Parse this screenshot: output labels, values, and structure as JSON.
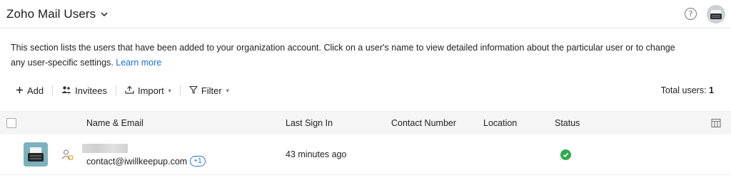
{
  "header": {
    "title": "Zoho Mail Users",
    "help_glyph": "?"
  },
  "description": {
    "text": "This section lists the users that have been added to your organization account. Click on a user's name to view detailed information about the particular user or to change any user-specific settings.",
    "link": "Learn more"
  },
  "toolbar": {
    "add_label": "Add",
    "invitees_label": "Invitees",
    "import_label": "Import",
    "filter_label": "Filter",
    "total_label": "Total users:",
    "total_value": "1"
  },
  "table": {
    "columns": {
      "name_email": "Name & Email",
      "last_sign_in": "Last Sign In",
      "contact_number": "Contact Number",
      "location": "Location",
      "status": "Status"
    },
    "rows": [
      {
        "email": "contact@iwillkeepup.com",
        "extra_count": "+1",
        "last_sign_in": "43 minutes ago",
        "contact_number": "",
        "location": "",
        "status": "active"
      }
    ]
  },
  "colors": {
    "link": "#1a6fd6",
    "status_active": "#2eab4f",
    "header_bg": "#f5f5f5"
  },
  "icons": {
    "title_dropdown": "chevron-down-icon",
    "help": "help-circle-icon",
    "add": "plus-icon",
    "invitees": "users-icon",
    "import": "upload-icon",
    "filter": "filter-icon",
    "columns": "column-settings-icon",
    "row_role": "admin-user-icon",
    "status": "check-circle-icon"
  }
}
